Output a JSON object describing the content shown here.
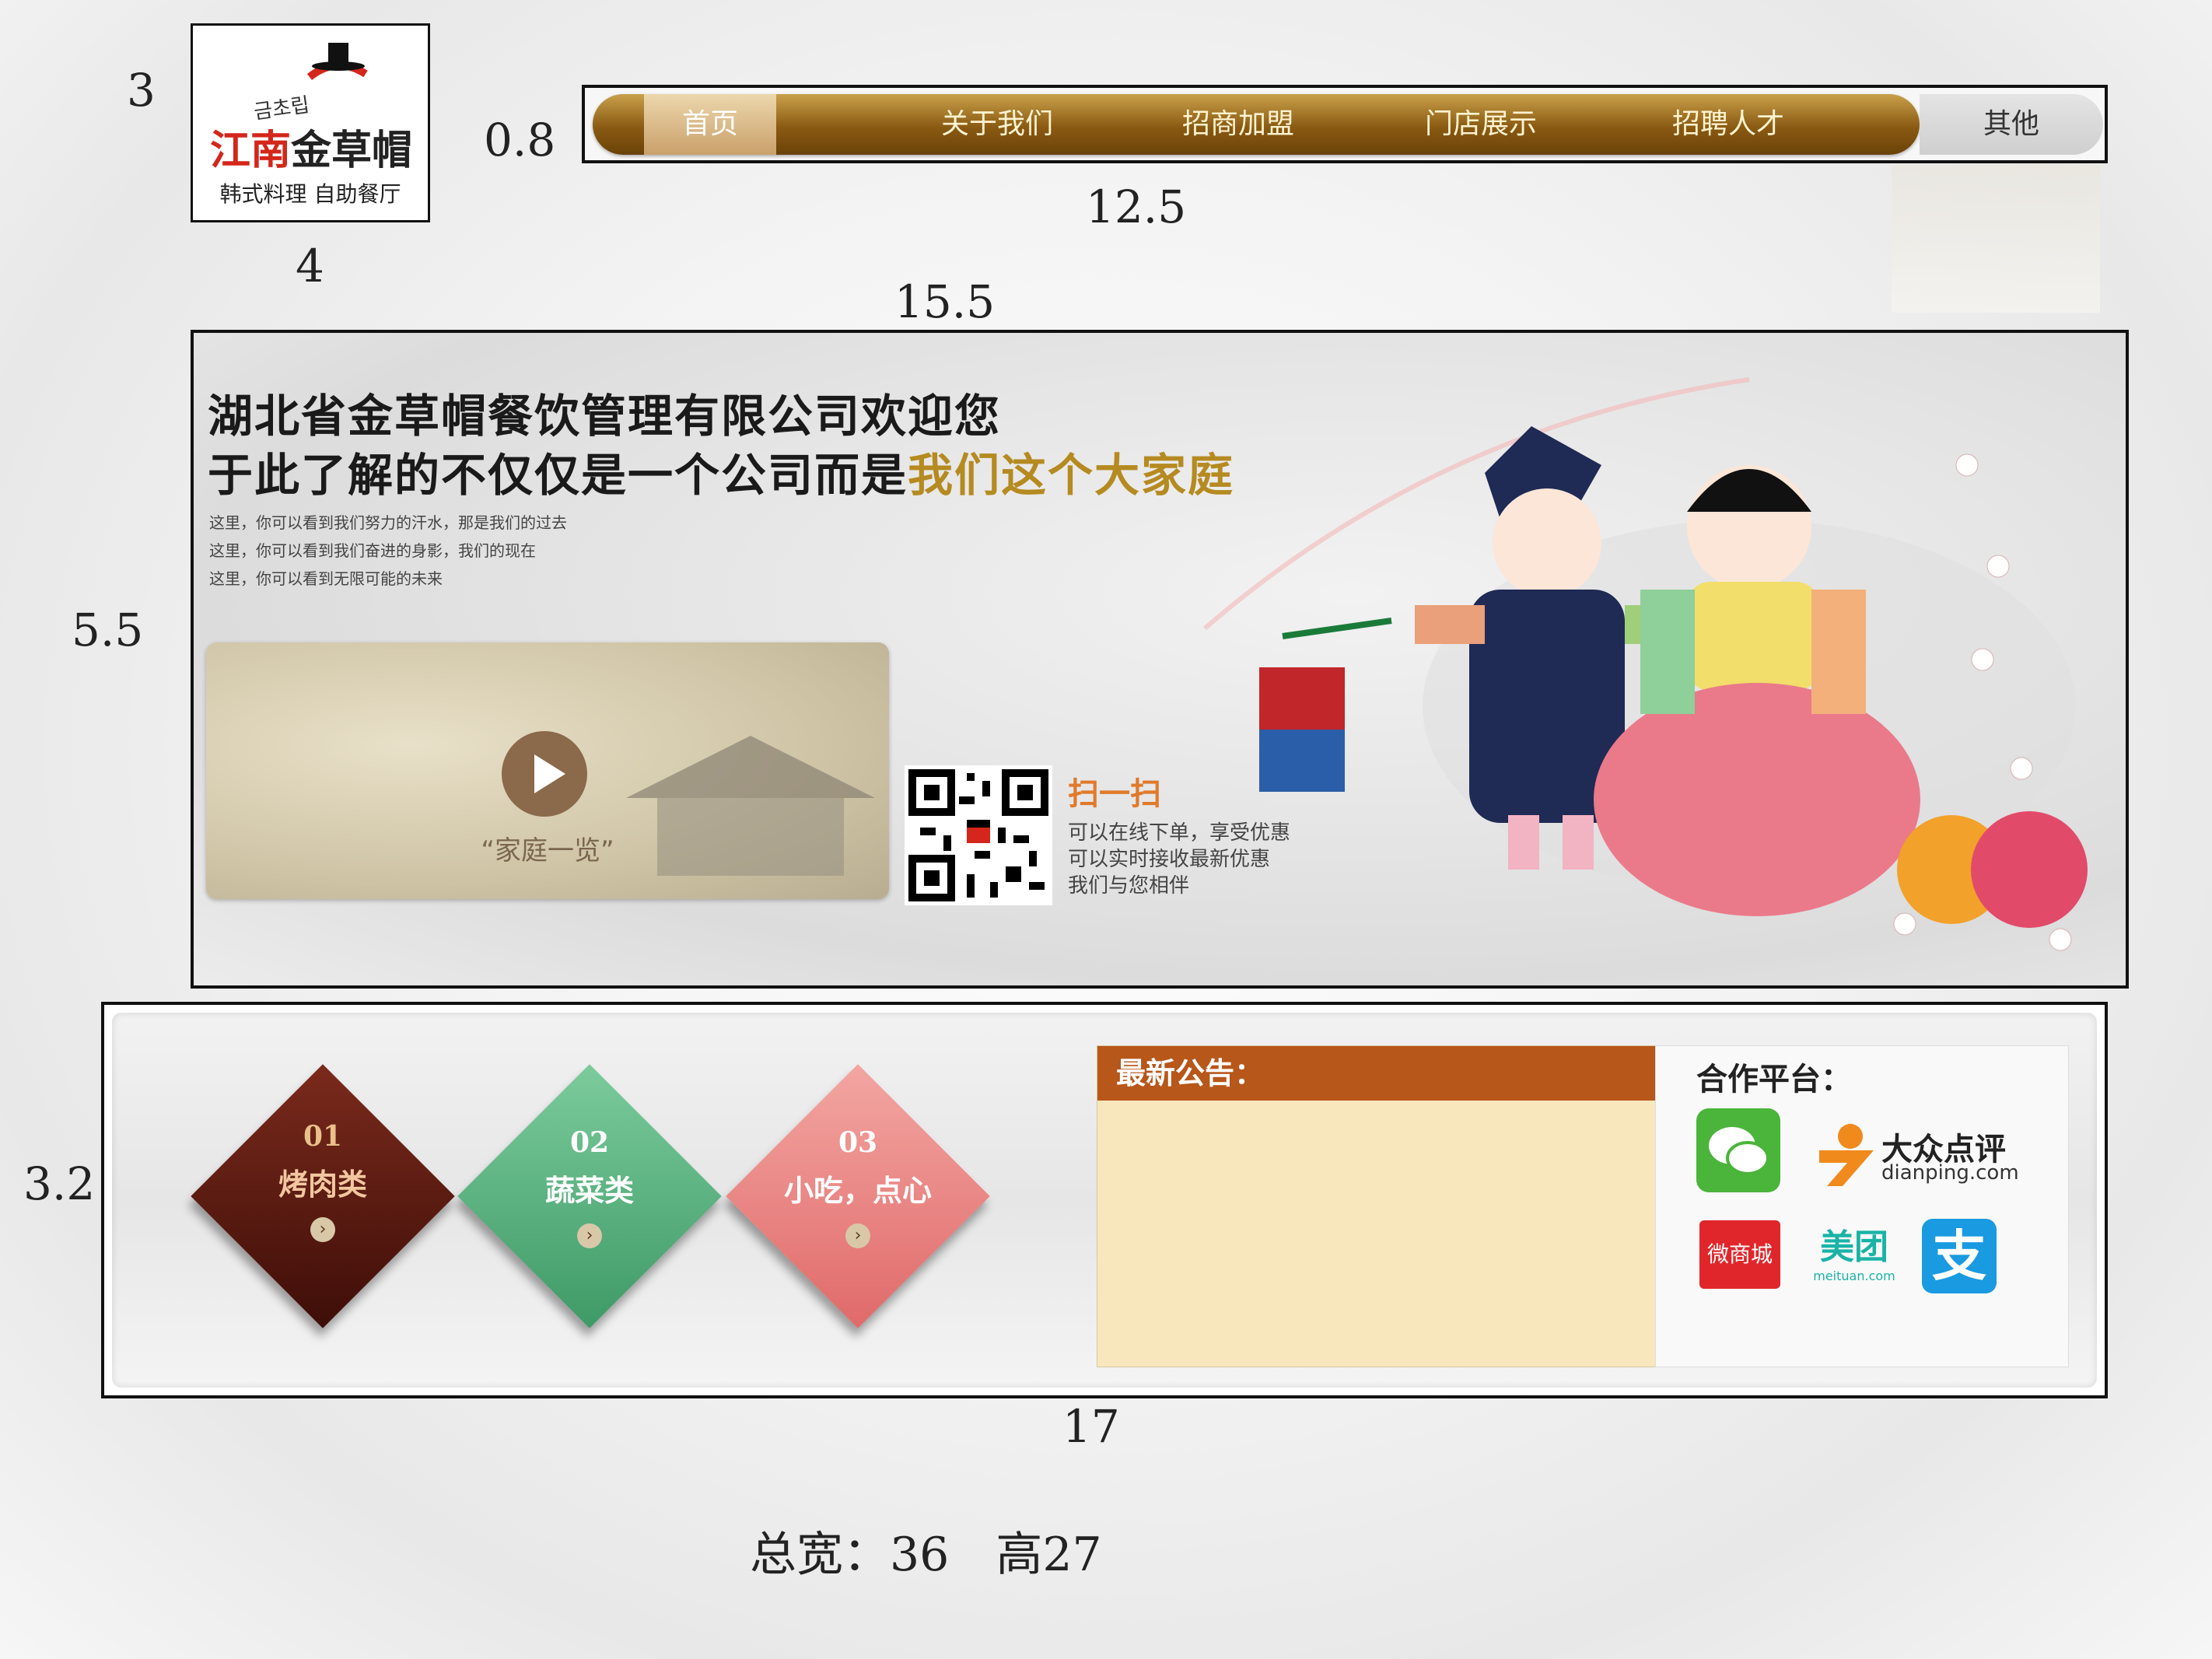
{
  "annotations": {
    "logo_left": "3",
    "logo_bottom": "4",
    "nav_gap": "0.8",
    "nav_width": "12.5",
    "top_gap": "15.5",
    "banner_height": "5.5",
    "panel_height": "3.2",
    "panel_width": "17",
    "total": "总宽：36　高27"
  },
  "logo": {
    "korean": "금초립",
    "name_red": "江南",
    "name_dark": "金草帽",
    "subtitle": "韩式料理 自助餐厅"
  },
  "nav": {
    "items": [
      "首页",
      "关于我们",
      "招商加盟",
      "门店展示",
      "招聘人才"
    ],
    "other": "其他"
  },
  "banner": {
    "headline_1": "湖北省金草帽餐饮管理有限公司欢迎您",
    "headline_2_dark": "于此了解的不仅仅是一个公司而是",
    "headline_2_gold": "我们这个大家庭",
    "desc": [
      "这里，你可以看到我们努力的汗水，那是我们的过去",
      "这里，你可以看到我们奋进的身影，我们的现在",
      "这里，你可以看到无限可能的未来"
    ],
    "video_label": "“家庭一览”",
    "scan_title": "扫一扫",
    "scan_lines": [
      "可以在线下单，享受优惠",
      "可以实时接收最新优惠",
      "我们与您相伴"
    ]
  },
  "categories": [
    {
      "num": "01",
      "name": "烤肉类",
      "color": "#5a1a12"
    },
    {
      "num": "02",
      "name": "蔬菜类",
      "color": "#5aae7e"
    },
    {
      "num": "03",
      "name": "小吃，点心",
      "color": "#e88a88"
    }
  ],
  "notice": {
    "title": "最新公告："
  },
  "partners": {
    "title": "合作平台：",
    "dianping_cn": "大众点评",
    "dianping_en": "dianping.com",
    "weishangcheng": "微商城",
    "meituan_cn": "美团",
    "meituan_en": "meituan.com",
    "alipay": "支"
  }
}
